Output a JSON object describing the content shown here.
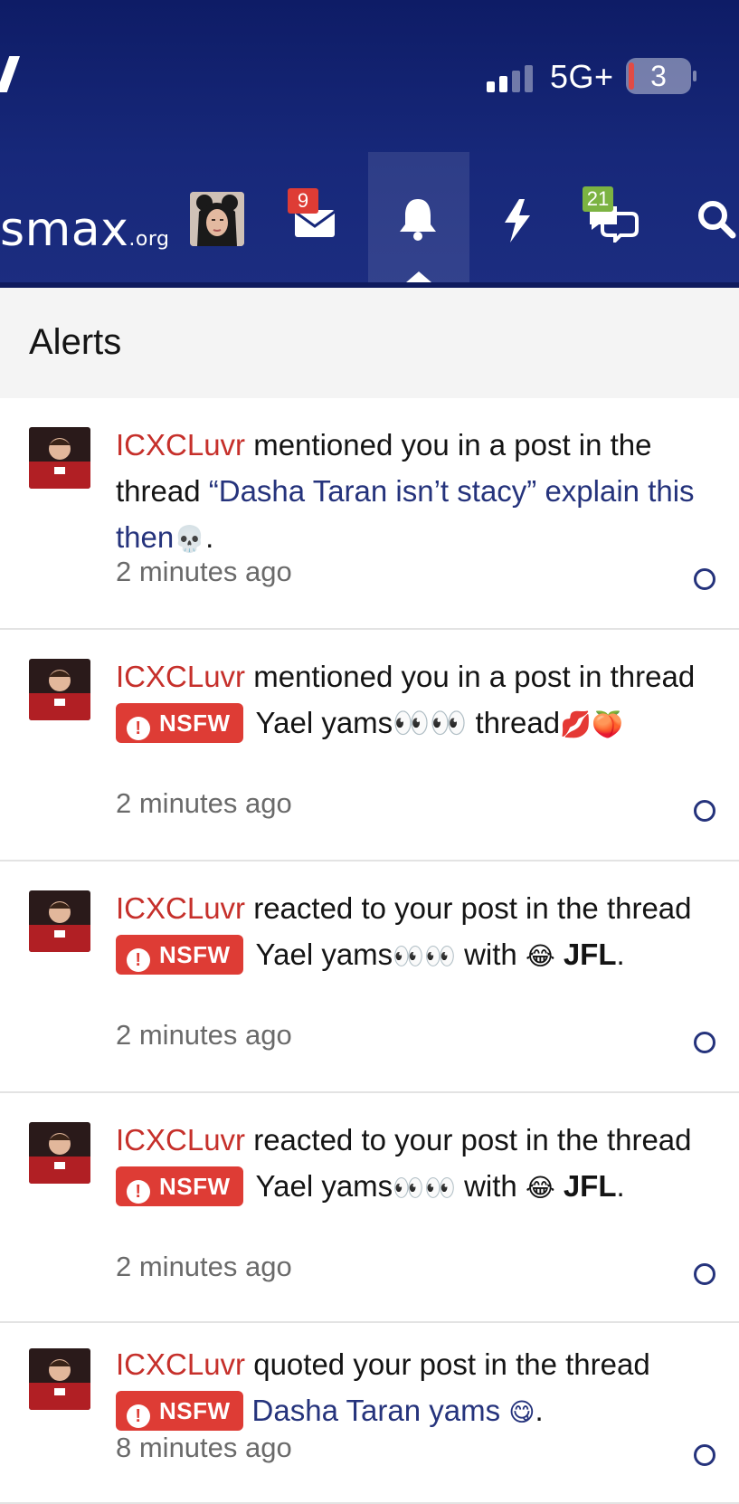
{
  "status_bar": {
    "network": "5G+",
    "battery": "3",
    "signal_bars": [
      true,
      true,
      false,
      false
    ]
  },
  "nav": {
    "logo": "smax",
    "logo_tld": ".org",
    "inbox_badge": "9",
    "chat_badge": "21",
    "colors": {
      "header": "#17287a",
      "inbox_badge": "#de3c35",
      "chat_badge": "#7cb342"
    }
  },
  "alerts": {
    "title": "Alerts",
    "items": [
      {
        "user": "ICXCLuvr",
        "text1": " mentioned you in a post in the thread ",
        "nsfw": "",
        "thread": "“Dasha Taran isn’t stacy” explain this then",
        "thread_emoji": "💀",
        "text2": ".",
        "reaction": "",
        "time": "2 minutes ago"
      },
      {
        "user": "ICXCLuvr",
        "text1": " mentioned you in a post in thread ",
        "nsfw": "NSFW",
        "thread": "Yael yams👀👀 thread",
        "thread_emoji": "💋🍑",
        "text2": "",
        "reaction": "",
        "time": "2 minutes ago"
      },
      {
        "user": "ICXCLuvr",
        "text1": " reacted to your post in the thread ",
        "nsfw": "NSFW",
        "thread": "Yael yams",
        "thread_emoji": "👀👀",
        "text2": " with ",
        "reaction_emoji": "😂",
        "reaction": "JFL",
        "text3": ".",
        "time": "2 minutes ago"
      },
      {
        "user": "ICXCLuvr",
        "text1": " reacted to your post in the thread ",
        "nsfw": "NSFW",
        "thread": "Yael yams",
        "thread_emoji": "👀👀",
        "text2": " with ",
        "reaction_emoji": "😂",
        "reaction": "JFL",
        "text3": ".",
        "time": "2 minutes ago"
      },
      {
        "user": "ICXCLuvr",
        "text1": " quoted your post in the thread ",
        "nsfw": "NSFW",
        "thread": "Dasha Taran yams",
        "thread_emoji": "😋",
        "text2": ".",
        "reaction": "",
        "time": "8 minutes ago"
      }
    ]
  }
}
